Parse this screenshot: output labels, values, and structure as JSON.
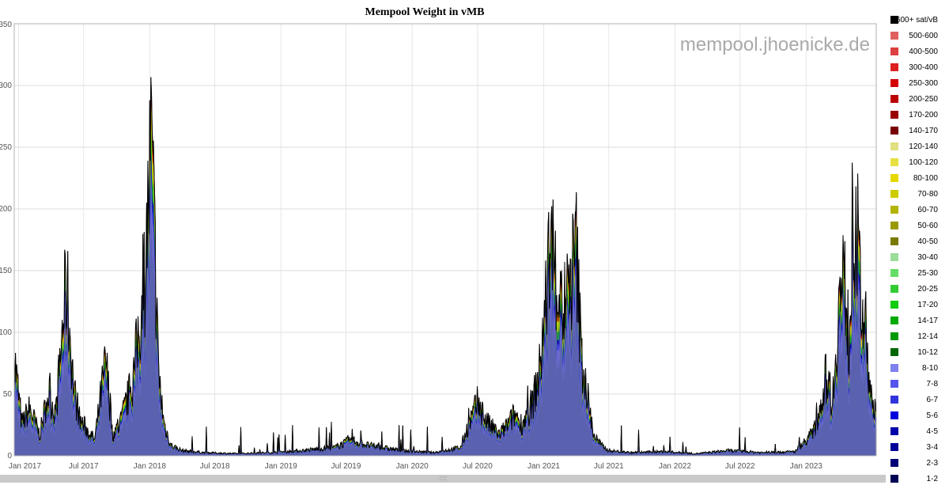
{
  "watermark": "mempool.jhoenicke.de",
  "chart_data": {
    "type": "area",
    "title": "Mempool Weight in vMB",
    "xlabel": "",
    "ylabel": "",
    "x_range": [
      "2016-12-20",
      "2023-07-15"
    ],
    "ylim": [
      0,
      350
    ],
    "y_ticks": [
      0,
      50,
      100,
      150,
      200,
      250,
      300,
      350
    ],
    "y_tick_labels": [
      "0",
      "50",
      "100",
      "150",
      "200",
      "250",
      "300",
      "350"
    ],
    "x_ticks": [
      "2017-01-01",
      "2017-07-01",
      "2018-01-01",
      "2018-07-01",
      "2019-01-01",
      "2019-07-01",
      "2020-01-01",
      "2020-07-01",
      "2021-01-01",
      "2021-07-01",
      "2022-01-01",
      "2022-07-01",
      "2023-01-01"
    ],
    "x_tick_labels": [
      "Jan 2017",
      "Jul 2017",
      "Jan 2018",
      "Jul 2018",
      "Jan 2019",
      "Jul 2019",
      "Jan 2020",
      "Jul 2020",
      "Jan 2021",
      "Jul 2021",
      "Jan 2022",
      "Jul 2022",
      "Jan 2023"
    ],
    "grid": true,
    "legend_position": "right",
    "legend": [
      {
        "label": "600+ sat/vB",
        "color": "#000000"
      },
      {
        "label": "500-600",
        "color": "#e06060"
      },
      {
        "label": "400-500",
        "color": "#dd4040"
      },
      {
        "label": "300-400",
        "color": "#dd2020"
      },
      {
        "label": "250-300",
        "color": "#d40000"
      },
      {
        "label": "200-250",
        "color": "#bb0000"
      },
      {
        "label": "170-200",
        "color": "#990000"
      },
      {
        "label": "140-170",
        "color": "#770000"
      },
      {
        "label": "120-140",
        "color": "#e0e080"
      },
      {
        "label": "100-120",
        "color": "#e6e040"
      },
      {
        "label": "80-100",
        "color": "#e6d800"
      },
      {
        "label": "70-80",
        "color": "#cccc00"
      },
      {
        "label": "60-70",
        "color": "#b3b300"
      },
      {
        "label": "50-60",
        "color": "#999900"
      },
      {
        "label": "40-50",
        "color": "#7a7a00"
      },
      {
        "label": "30-40",
        "color": "#99dd99"
      },
      {
        "label": "25-30",
        "color": "#66dd66"
      },
      {
        "label": "20-25",
        "color": "#33cc33"
      },
      {
        "label": "17-20",
        "color": "#11cc11"
      },
      {
        "label": "14-17",
        "color": "#00aa00"
      },
      {
        "label": "12-14",
        "color": "#009900"
      },
      {
        "label": "10-12",
        "color": "#006600"
      },
      {
        "label": "8-10",
        "color": "#8080ee"
      },
      {
        "label": "7-8",
        "color": "#5555ee"
      },
      {
        "label": "6-7",
        "color": "#3333dd"
      },
      {
        "label": "5-6",
        "color": "#0000dd"
      },
      {
        "label": "4-5",
        "color": "#0000aa"
      },
      {
        "label": "3-4",
        "color": "#000099"
      },
      {
        "label": "2-3",
        "color": "#000077"
      },
      {
        "label": "1-2",
        "color": "#000055"
      }
    ],
    "series": [
      {
        "color": "#000000",
        "x": [
          "2016-12-20",
          "2017-01-10",
          "2017-02-01",
          "2017-03-01",
          "2017-03-25",
          "2017-04-15",
          "2017-05-05",
          "2017-05-15",
          "2017-05-25",
          "2017-06-05",
          "2017-06-20",
          "2017-07-10",
          "2017-08-01",
          "2017-08-15",
          "2017-09-01",
          "2017-09-20",
          "2017-10-10",
          "2017-11-01",
          "2017-11-15",
          "2017-12-01",
          "2017-12-10",
          "2017-12-20",
          "2017-12-28",
          "2018-01-05",
          "2018-01-15",
          "2018-01-25",
          "2018-02-10",
          "2018-03-01",
          "2018-04-01",
          "2018-06-01",
          "2018-09-01",
          "2018-12-01",
          "2019-03-01",
          "2019-06-01",
          "2019-07-15",
          "2019-09-01",
          "2019-12-01",
          "2020-03-01",
          "2020-05-15",
          "2020-06-01",
          "2020-07-01",
          "2020-08-01",
          "2020-09-01",
          "2020-10-15",
          "2020-11-01",
          "2020-12-01",
          "2020-12-20",
          "2021-01-05",
          "2021-01-20",
          "2021-02-05",
          "2021-02-25",
          "2021-03-15",
          "2021-04-01",
          "2021-04-15",
          "2021-05-01",
          "2021-05-20",
          "2021-06-10",
          "2021-07-01",
          "2021-09-01",
          "2021-12-01",
          "2022-03-01",
          "2022-06-01",
          "2022-09-01",
          "2022-12-01",
          "2023-01-15",
          "2023-02-01",
          "2023-02-15",
          "2023-03-01",
          "2023-03-15",
          "2023-04-01",
          "2023-04-15",
          "2023-05-01",
          "2023-05-10",
          "2023-05-20",
          "2023-06-01",
          "2023-06-15",
          "2023-07-05"
        ],
        "values": [
          95,
          30,
          45,
          20,
          60,
          40,
          130,
          165,
          110,
          60,
          35,
          25,
          15,
          50,
          90,
          20,
          30,
          55,
          70,
          120,
          140,
          180,
          240,
          300,
          200,
          80,
          30,
          10,
          5,
          3,
          2,
          3,
          5,
          8,
          15,
          10,
          5,
          3,
          8,
          25,
          50,
          30,
          20,
          40,
          30,
          50,
          80,
          140,
          210,
          170,
          140,
          160,
          200,
          100,
          60,
          20,
          10,
          5,
          3,
          4,
          2,
          5,
          3,
          4,
          20,
          30,
          60,
          80,
          50,
          140,
          170,
          110,
          200,
          230,
          150,
          120,
          40
        ]
      }
    ],
    "stack_bands": [
      {
        "color": "#5a62b0",
        "fraction": 0.62
      },
      {
        "color": "#6a6acc",
        "fraction": 0.12
      },
      {
        "color": "#3333dd",
        "fraction": 0.04
      },
      {
        "color": "#0000aa",
        "fraction": 0.03
      },
      {
        "color": "#22bb22",
        "fraction": 0.06
      },
      {
        "color": "#d8cc10",
        "fraction": 0.07
      },
      {
        "color": "#aa0000",
        "fraction": 0.03
      },
      {
        "color": "#000000",
        "fraction": 0.03
      }
    ]
  }
}
